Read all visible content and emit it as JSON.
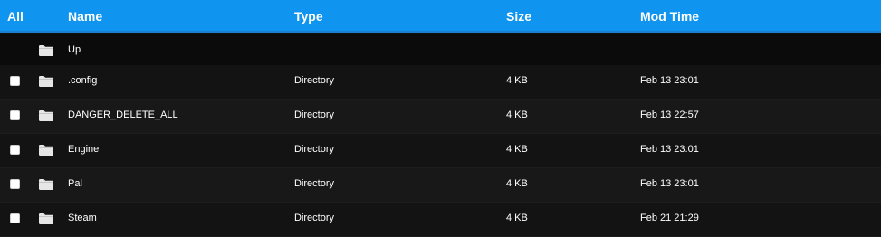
{
  "header": {
    "all_label": "All",
    "name_label": "Name",
    "type_label": "Type",
    "size_label": "Size",
    "mod_label": "Mod Time"
  },
  "colors": {
    "header_bg": "#0f94f0",
    "row_odd": "#131313",
    "row_even": "#181818"
  },
  "up_row": {
    "icon": "folder-icon",
    "name": "Up"
  },
  "rows": [
    {
      "name": ".config",
      "type": "Directory",
      "size": "4 KB",
      "mod": "Feb 13 23:01",
      "icon": "folder-icon",
      "checked": false
    },
    {
      "name": "DANGER_DELETE_ALL",
      "type": "Directory",
      "size": "4 KB",
      "mod": "Feb 13 22:57",
      "icon": "folder-icon",
      "checked": false
    },
    {
      "name": "Engine",
      "type": "Directory",
      "size": "4 KB",
      "mod": "Feb 13 23:01",
      "icon": "folder-icon",
      "checked": false
    },
    {
      "name": "Pal",
      "type": "Directory",
      "size": "4 KB",
      "mod": "Feb 13 23:01",
      "icon": "folder-icon",
      "checked": false
    },
    {
      "name": "Steam",
      "type": "Directory",
      "size": "4 KB",
      "mod": "Feb 21 21:29",
      "icon": "folder-icon",
      "checked": false
    }
  ]
}
